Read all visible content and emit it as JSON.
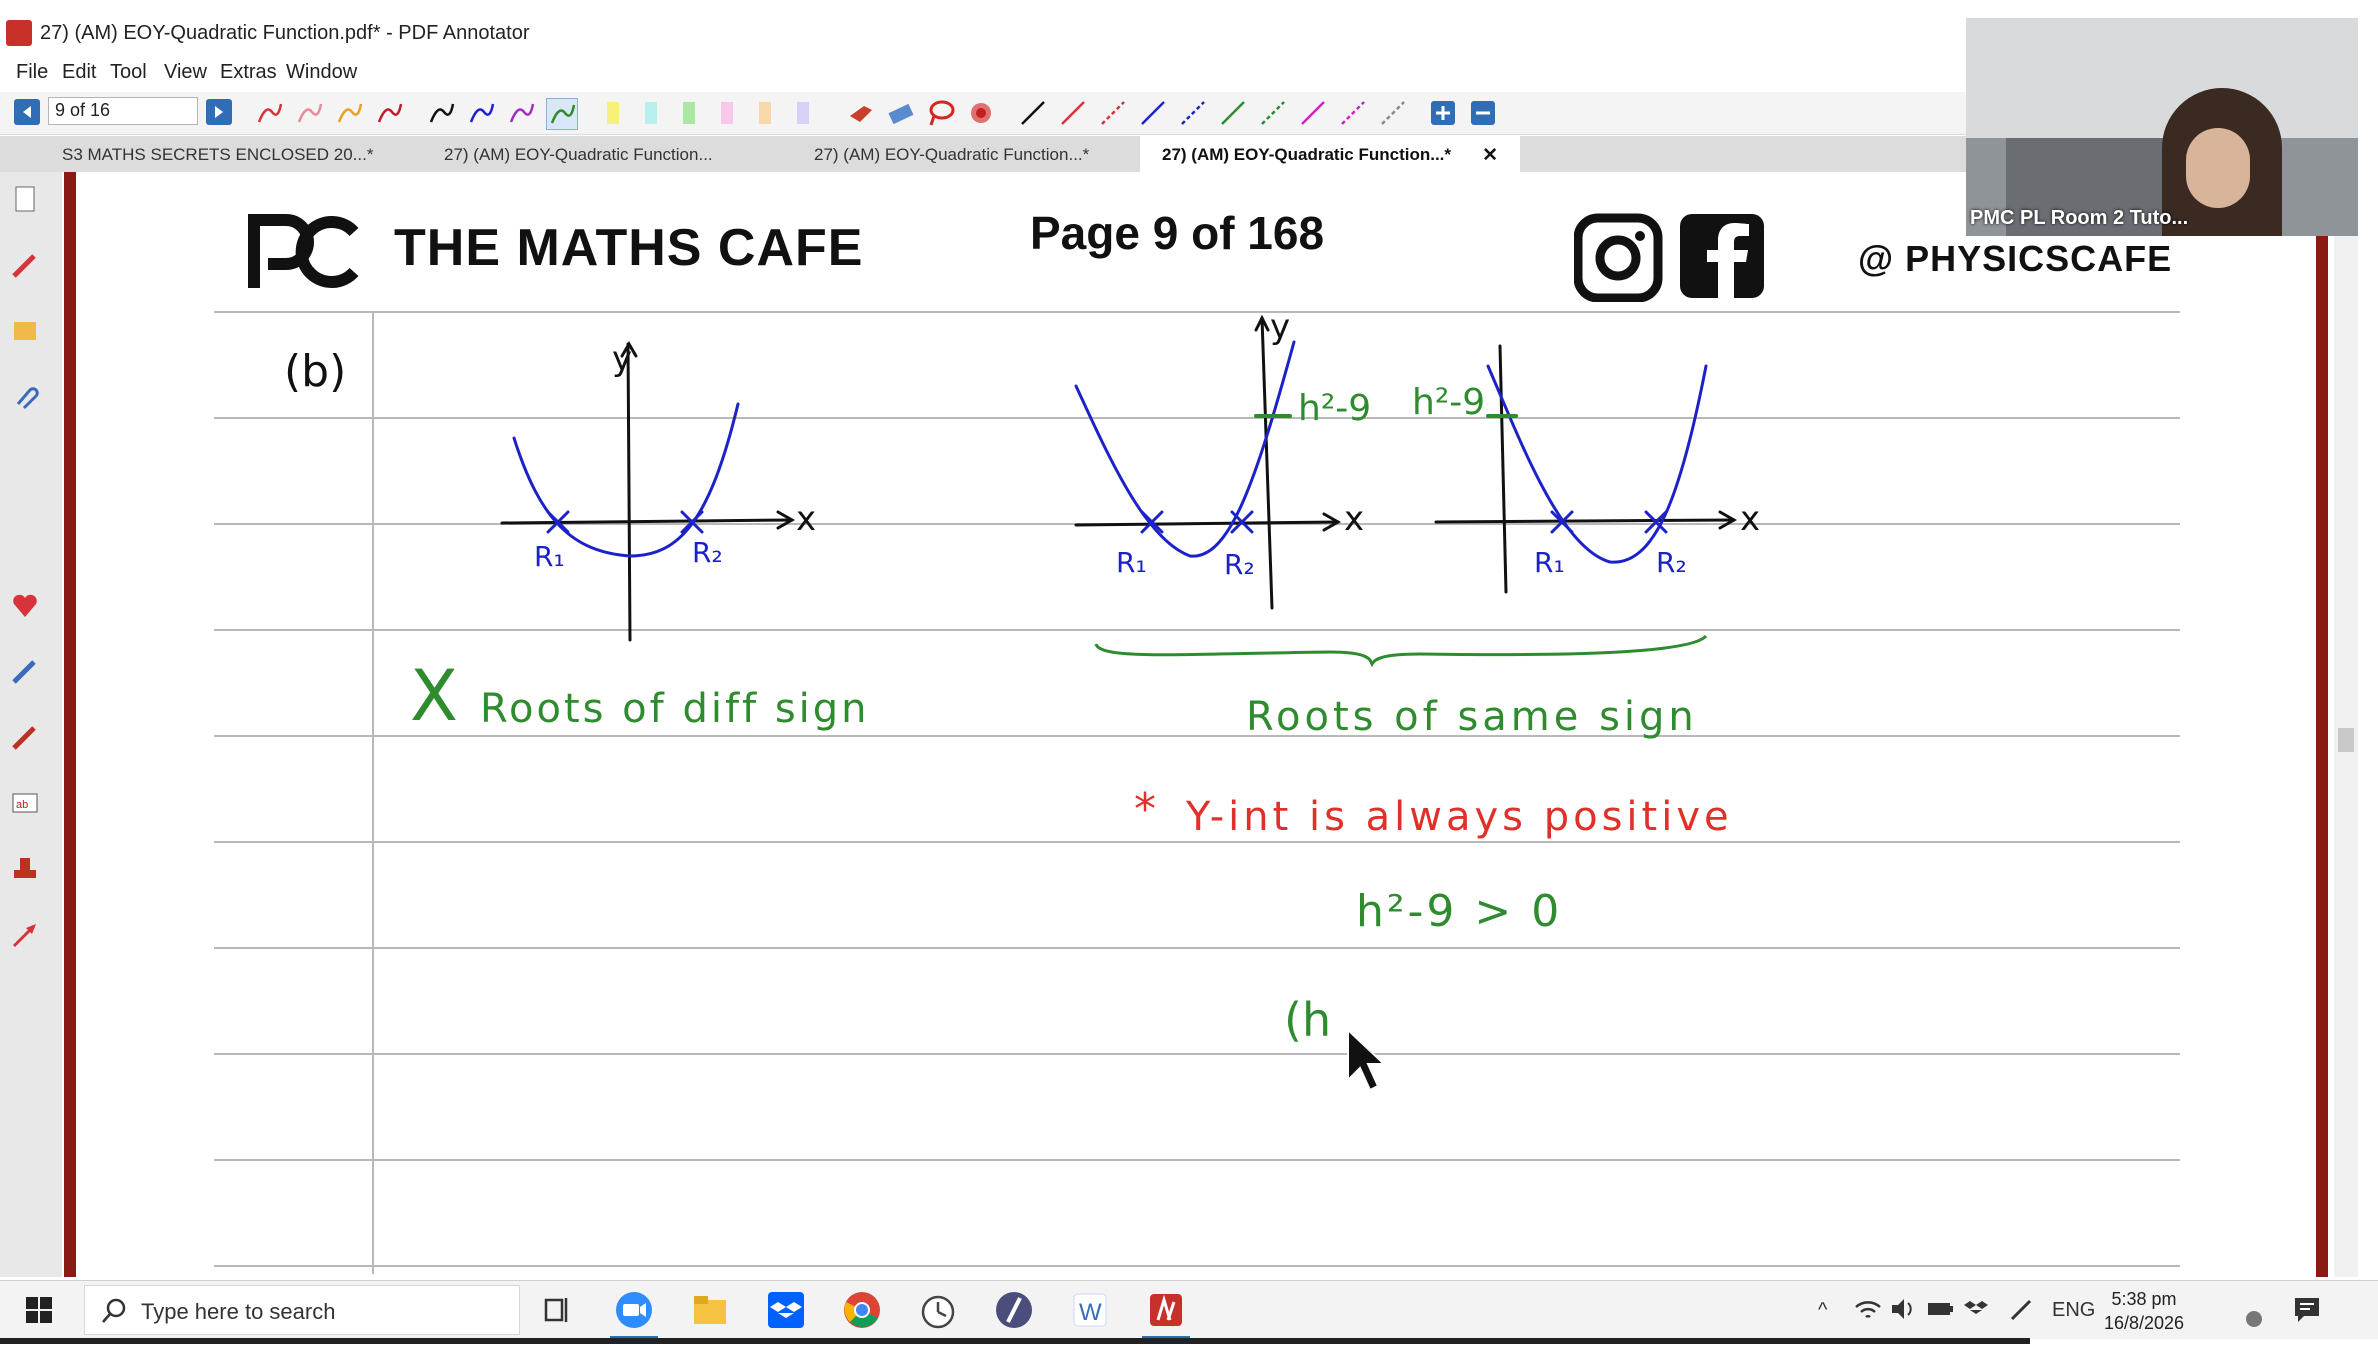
{
  "window": {
    "title": "27) (AM) EOY-Quadratic Function.pdf* - PDF Annotator"
  },
  "menu": [
    "File",
    "Edit",
    "Tool",
    "View",
    "Extras",
    "Window"
  ],
  "toolbar": {
    "page_indicator": "9 of 16"
  },
  "tabs": [
    {
      "label": "S3 MATHS SECRETS ENCLOSED 20...*",
      "active": false
    },
    {
      "label": "27) (AM) EOY-Quadratic Function...",
      "active": false
    },
    {
      "label": "27) (AM) EOY-Quadratic Function...*",
      "active": false
    },
    {
      "label": "27) (AM) EOY-Quadratic Function...*",
      "active": true,
      "close": "✕"
    }
  ],
  "document": {
    "brand": "THE MATHS CAFE",
    "page_label": "Page 9 of 168",
    "social_handle": "@ PHYSICSCAFE",
    "social_icons": [
      "instagram-icon",
      "facebook-icon"
    ]
  },
  "handwriting": {
    "part_label": "(b)",
    "graph1": {
      "y": "y",
      "x": "x",
      "r1": "R₁",
      "r2": "R₂"
    },
    "graph2": {
      "y": "y",
      "x": "x",
      "r1": "R₁",
      "r2": "R₂",
      "intercept": "h²-9"
    },
    "graph3": {
      "x": "x",
      "r1": "R₁",
      "r2": "R₂",
      "intercept": "h²-9"
    },
    "cross_note": "X",
    "diff_sign": "Roots of diff sign",
    "same_sign": "Roots of same sign",
    "yint_star": "*",
    "yint_note": "Y-int is always positive",
    "inequality": "h²-9 > 0",
    "partial": "(h"
  },
  "colors": {
    "ink_blue": "#1c22c8",
    "ink_green": "#2e8b2e",
    "ink_red": "#e0302a",
    "frame": "#8a1a14"
  },
  "webcam": {
    "label": "PMC PL Room 2 Tuto..."
  },
  "taskbar": {
    "search_placeholder": "Type here to search",
    "lang": "ENG",
    "time": "5:38 pm",
    "date": "16/8/2026",
    "apps": [
      "task-view-icon",
      "zoom-icon",
      "file-explorer-icon",
      "dropbox-icon",
      "chrome-icon",
      "clock-app-icon",
      "quill-icon",
      "word-icon",
      "pdf-annotator-icon"
    ]
  }
}
